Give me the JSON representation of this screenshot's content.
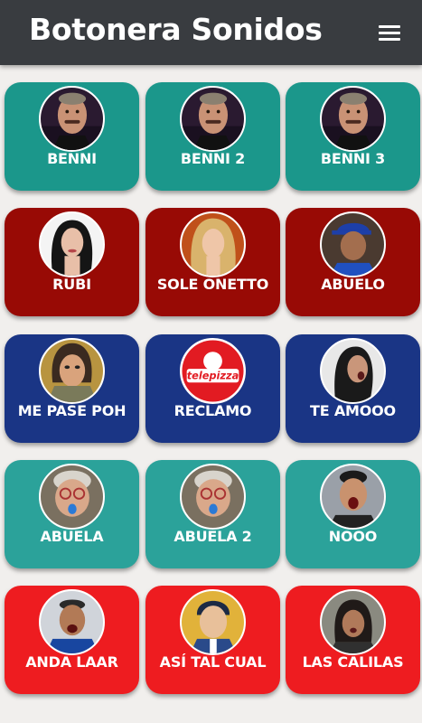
{
  "app": {
    "title": "Botonera Sonidos",
    "menu_icon": "hamburger-menu-icon"
  },
  "colors": {
    "appbar": "#393c40",
    "background": "#f1efed",
    "teal": "#1b978b",
    "darkred": "#980a05",
    "navy": "#1a3585",
    "lightteal": "#2ba29a",
    "red": "#ee1c20"
  },
  "buttons": [
    {
      "label": "BENNI",
      "color": "#1b978b",
      "avatar": "man-mustache-portrait"
    },
    {
      "label": "BENNI 2",
      "color": "#1b978b",
      "avatar": "man-mustache-portrait"
    },
    {
      "label": "BENNI 3",
      "color": "#1b978b",
      "avatar": "man-mustache-portrait"
    },
    {
      "label": "RUBI",
      "color": "#980a05",
      "avatar": "woman-dark-hair-portrait"
    },
    {
      "label": "SOLE ONETTO",
      "color": "#980a05",
      "avatar": "woman-blonde-portrait"
    },
    {
      "label": "ABUELO",
      "color": "#980a05",
      "avatar": "old-man-cap-portrait"
    },
    {
      "label": "ME PASE POH",
      "color": "#1a3585",
      "avatar": "cartoon-woman-portrait"
    },
    {
      "label": "RECLAMO",
      "color": "#1a3585",
      "avatar": "telepizza-logo"
    },
    {
      "label": "TE AMOOO",
      "color": "#1a3585",
      "avatar": "woman-shouting-portrait"
    },
    {
      "label": "ABUELA",
      "color": "#2ba29a",
      "avatar": "old-woman-tongue-portrait"
    },
    {
      "label": "ABUELA 2",
      "color": "#2ba29a",
      "avatar": "old-woman-tongue-portrait"
    },
    {
      "label": "NOOO",
      "color": "#2ba29a",
      "avatar": "man-shouting-portrait"
    },
    {
      "label": "ANDA LAAR",
      "color": "#ee1c20",
      "avatar": "man-yelling-portrait"
    },
    {
      "label": "ASÍ TAL CUAL",
      "color": "#ee1c20",
      "avatar": "cartoon-man-portrait"
    },
    {
      "label": "LAS CALILAS",
      "color": "#ee1c20",
      "avatar": "woman-crowd-portrait"
    }
  ],
  "logo_text": "telepizza"
}
